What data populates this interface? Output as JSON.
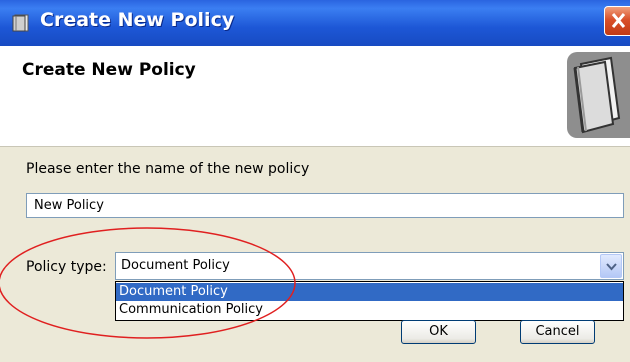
{
  "window": {
    "title": "Create New Policy"
  },
  "header": {
    "title": "Create New Policy",
    "icon": "book-icon"
  },
  "form": {
    "prompt": "Please enter the name of the new policy",
    "name_value": "New Policy",
    "type_label": "Policy type:",
    "type_selected": "Document Policy",
    "type_options": [
      "Document Policy",
      "Communication Policy"
    ]
  },
  "buttons": {
    "ok": "OK",
    "cancel": "Cancel"
  },
  "colors": {
    "titlebar": "#1d57d6",
    "selection": "#316ac5",
    "annotation": "#e02020"
  }
}
